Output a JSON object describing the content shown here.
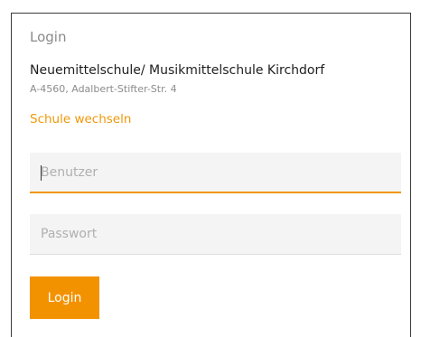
{
  "login": {
    "title": "Login",
    "school_name": "Neuemittelschule/ Musikmittelschule Kirchdorf",
    "school_address": "A-4560, Adalbert-Stifter-Str. 4",
    "change_school_label": "Schule wechseln",
    "username": {
      "value": "",
      "placeholder": "Benutzer"
    },
    "password": {
      "value": "",
      "placeholder": "Passwort"
    },
    "submit_label": "Login"
  },
  "colors": {
    "accent": "#f39200",
    "link": "#f0980a",
    "field_background": "#f4f4f4",
    "border": "#3a3a3a"
  }
}
